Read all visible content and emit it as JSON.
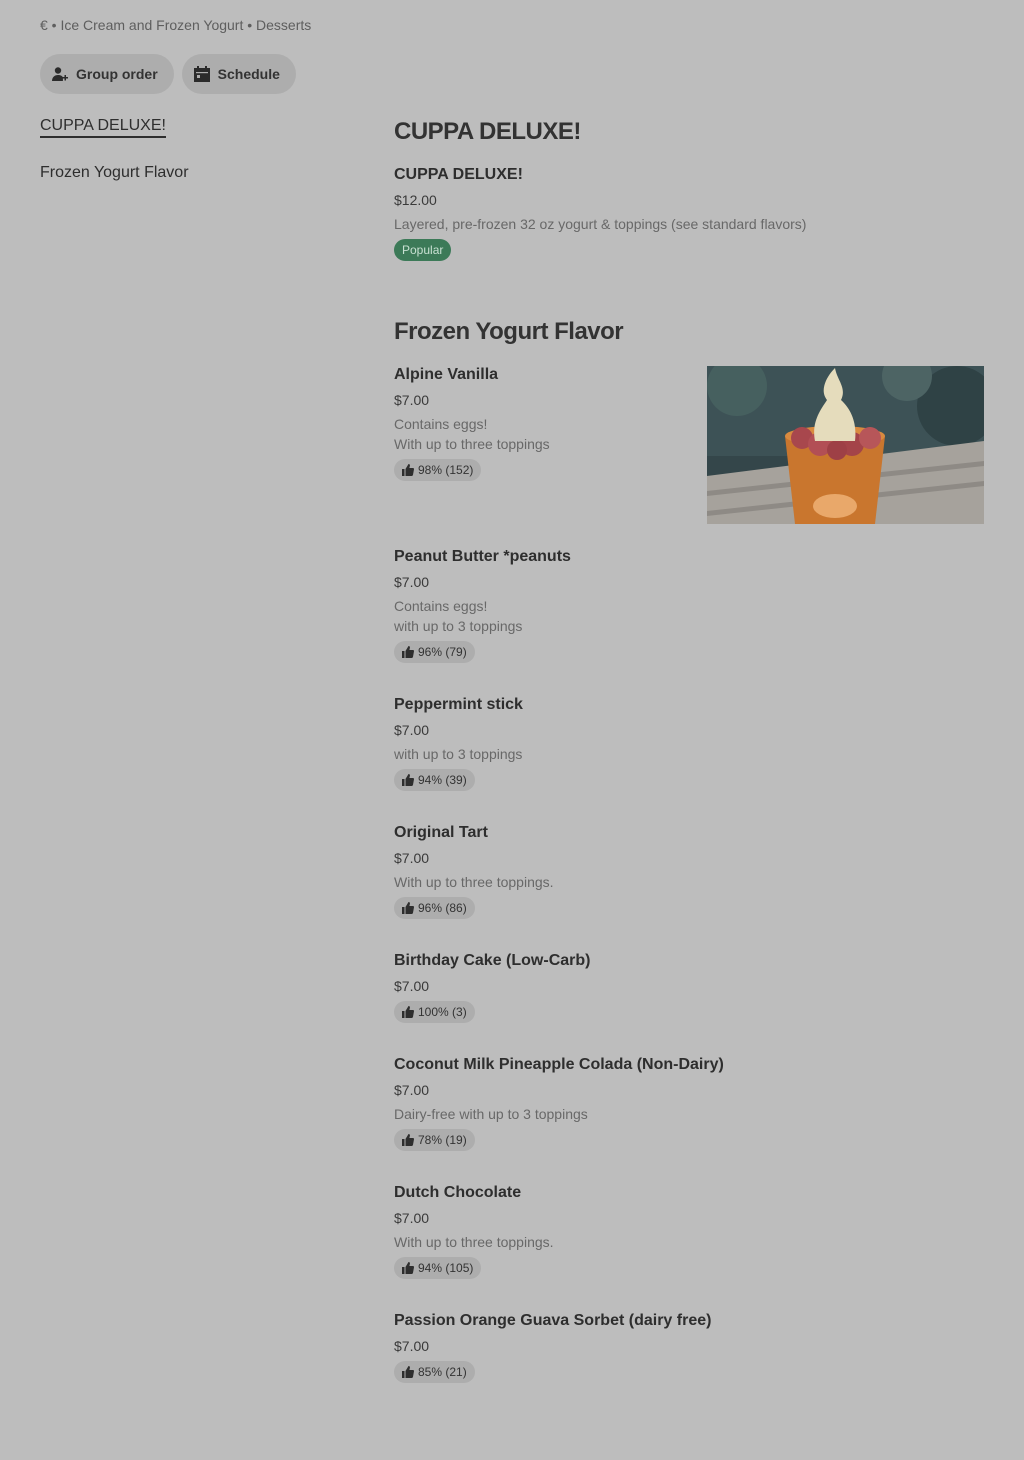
{
  "header": {
    "meta": "€ • Ice Cream and Frozen Yogurt • Desserts",
    "group_order_label": "Group order",
    "schedule_label": "Schedule"
  },
  "sidebar": {
    "items": [
      {
        "label": "CUPPA DELUXE!"
      },
      {
        "label": "Frozen Yogurt Flavor"
      }
    ]
  },
  "sections": [
    {
      "title": "CUPPA DELUXE!",
      "items": [
        {
          "name": "CUPPA DELUXE!",
          "price": "$12.00",
          "desc": [
            "Layered, pre-frozen 32 oz yogurt & toppings (see standard flavors)"
          ],
          "tag": "Popular"
        }
      ]
    },
    {
      "title": "Frozen Yogurt Flavor",
      "items": [
        {
          "name": "Alpine Vanilla",
          "price": "$7.00",
          "desc": [
            "Contains eggs!",
            "With up to three toppings"
          ],
          "rating": "98% (152)"
        },
        {
          "name": "Peanut Butter *peanuts",
          "price": "$7.00",
          "desc": [
            "Contains eggs!",
            "with up to 3 toppings"
          ],
          "rating": "96% (79)"
        },
        {
          "name": "Peppermint stick",
          "price": "$7.00",
          "desc": [
            "with up to 3 toppings"
          ],
          "rating": "94% (39)"
        },
        {
          "name": "Original Tart",
          "price": "$7.00",
          "desc": [
            "With up to three toppings."
          ],
          "rating": "96% (86)"
        },
        {
          "name": "Birthday Cake (Low-Carb)",
          "price": "$7.00",
          "desc": [],
          "rating": "100% (3)"
        },
        {
          "name": "Coconut Milk Pineapple Colada (Non-Dairy)",
          "price": "$7.00",
          "desc": [
            "Dairy-free with up to 3 toppings"
          ],
          "rating": "78% (19)"
        },
        {
          "name": "Dutch Chocolate",
          "price": "$7.00",
          "desc": [
            "With up to three toppings."
          ],
          "rating": "94% (105)"
        },
        {
          "name": "Passion Orange Guava Sorbet (dairy free)",
          "price": "$7.00",
          "desc": [],
          "rating": "85% (21)"
        }
      ]
    }
  ],
  "colors": {
    "background": "#bdbdbd",
    "pill": "#adadad",
    "popular": "#3c7a58"
  }
}
